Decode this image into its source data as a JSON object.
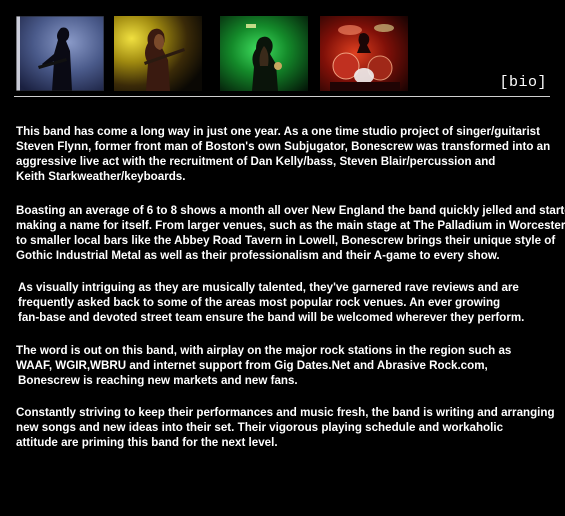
{
  "header": {
    "page_tag": "[bio]",
    "photos": [
      {
        "name": "guitarist-silhouette-photo",
        "dominant_color": "#3a4a7a"
      },
      {
        "name": "bassist-yellow-light-photo",
        "dominant_color": "#c8b020"
      },
      {
        "name": "band-green-light-photo",
        "dominant_color": "#1a8a2a"
      },
      {
        "name": "drummer-red-light-photo",
        "dominant_color": "#b02010"
      }
    ]
  },
  "bio": {
    "paragraphs": [
      {
        "lines": [
          "This band has come a long way in just one year.  As a one time studio project of singer/guitarist",
          "Steven Flynn, former front man of Boston's own Subjugator, Bonescrew was transformed into an",
          "aggressive live act with the recruitment of Dan Kelly/bass, Steven Blair/percussion and",
          "Keith Starkweather/keyboards."
        ]
      },
      {
        "lines": [
          "Boasting an average of 6 to 8 shows a month all over New England the band quickly jelled and started",
          "making a name for itself.  From larger venues, such as the main stage at The Palladium in Worcester,",
          "to smaller local bars like the Abbey Road Tavern in Lowell, Bonescrew brings their unique style of",
          "Gothic Industrial Metal as well as their professionalism and their A-game to every show."
        ]
      },
      {
        "lines": [
          "As  visually intriguing as they are musically talented, they've garnered rave reviews and are",
          "frequently  asked back to some of the areas most popular rock venues.  An ever growing",
          "fan-base  and devoted street team ensure the band will be welcomed wherever they perform."
        ]
      },
      {
        "lines": [
          "The word is out on this band, with airplay on the major rock stations in the region such as",
          "WAAF, WGIR,WBRU and internet support from Gig Dates.Net and Abrasive Rock.com,",
          "Bonescrew is reaching new markets and new fans."
        ]
      },
      {
        "lines": [
          "Constantly striving to keep their performances and music fresh, the band is writing and arranging",
          "new songs and new ideas into their set.  Their vigorous playing schedule and workaholic",
          "attitude  are priming this band for the next level."
        ]
      }
    ]
  },
  "colors": {
    "background": "#000000",
    "text": "#ffffff",
    "divider": "#cfcfcf"
  }
}
